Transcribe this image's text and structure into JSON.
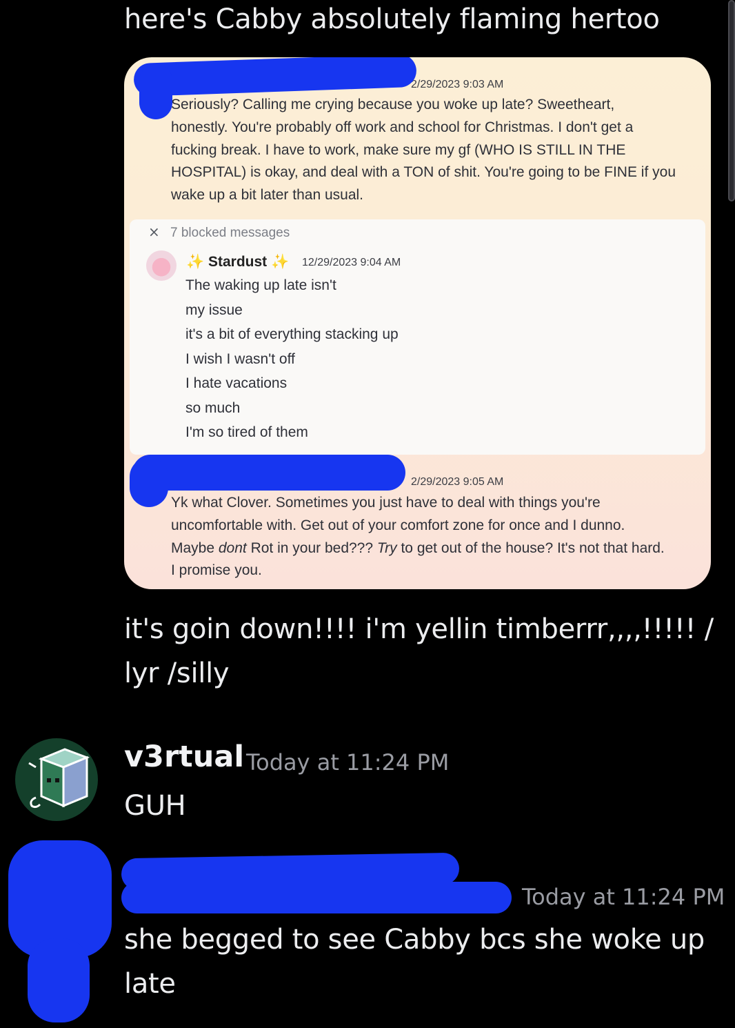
{
  "messages": {
    "top_text": "here's Cabby absolutely flaming hertoo",
    "down_text": "it's goin down!!!! i'm yellin timberrr,,,,!!!!! / lyr /silly",
    "v3rtual": {
      "username": "v3rtual",
      "timestamp": "Today at 11:24 PM",
      "text": "GUH"
    },
    "last": {
      "timestamp": "Today at 11:24 PM",
      "text": "she begged to see Cabby bcs she woke up late"
    }
  },
  "screenshot": {
    "msg1": {
      "timestamp": "2/29/2023 9:03 AM",
      "lines": [
        "Seriously? Calling me crying because you woke up late? Sweetheart,",
        "honestly. You're probably off work and school for Christmas. I don't get a",
        "fucking break. I have to work, make sure my gf (WHO IS STILL IN THE",
        "HOSPITAL) is okay, and deal with a TON of shit. You're going to be FINE if you",
        "wake up a bit later than usual."
      ]
    },
    "blocked": {
      "close": "×",
      "label": "7 blocked messages",
      "name": "Stardust",
      "timestamp": "12/29/2023 9:04 AM",
      "lines": [
        "The waking up late isn't",
        "my issue",
        "it's a bit of everything stacking up",
        "I wish I wasn't off",
        "I hate vacations",
        "so much",
        "I'm so tired of them"
      ]
    },
    "msg2": {
      "timestamp": "2/29/2023 9:05 AM",
      "line1": "Yk what Clover. Sometimes you just have to deal with things you're",
      "line2": "uncomfortable with. Get out of your comfort zone for once and I dunno.",
      "line3_a": "Maybe ",
      "line3_b": "dont",
      "line3_c": " Rot in your bed??? ",
      "line3_d": "Try",
      "line3_e": " to get out of the house? It's not that hard.",
      "line4": "I promise you."
    }
  },
  "colors": {
    "background": "#000000",
    "redaction": "#1736f0",
    "card": "#fcefd6",
    "timestamp": "#9a9ca3"
  }
}
